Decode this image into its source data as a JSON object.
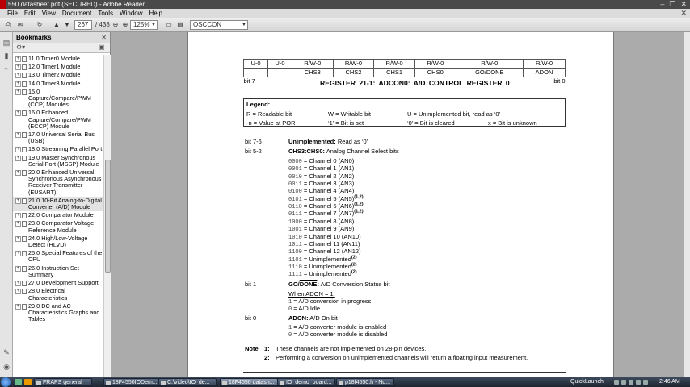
{
  "window": {
    "title": "550 datasheet.pdf (SECURED) - Adobe Reader",
    "controls": [
      "–",
      "❐",
      "✕"
    ]
  },
  "menu": [
    "File",
    "Edit",
    "View",
    "Document",
    "Tools",
    "Window",
    "Help"
  ],
  "toolbar": {
    "current_page": "267",
    "total_pages": "/ 438",
    "zoom": "125%",
    "search": "OSCCON"
  },
  "bookmarks_panel": {
    "title": "Bookmarks",
    "items": [
      {
        "label": "11.0 Timer0 Module",
        "expand": "+",
        "selected": false
      },
      {
        "label": "12.0 Timer1 Module",
        "expand": "+",
        "selected": false
      },
      {
        "label": "13.0 Timer2 Module",
        "expand": "+",
        "selected": false
      },
      {
        "label": "14.0 Timer3 Module",
        "expand": "+",
        "selected": false
      },
      {
        "label": "15.0 Capture/Compare/PWM (CCP) Modules",
        "expand": "+",
        "selected": false
      },
      {
        "label": "16.0 Enhanced Capture/Compare/PWM (ECCP) Module",
        "expand": "+",
        "selected": false
      },
      {
        "label": "17.0 Universal Serial Bus (USB)",
        "expand": "+",
        "selected": false
      },
      {
        "label": "18.0 Streaming Parallel Port",
        "expand": "+",
        "selected": false
      },
      {
        "label": "19.0 Master Synchronous Serial Port (MSSP) Module",
        "expand": "+",
        "selected": false
      },
      {
        "label": "20.0 Enhanced Universal Synchronous Asynchronous Receiver Transmitter (EUSART)",
        "expand": "+",
        "selected": false
      },
      {
        "label": "21.0 10-Bit Analog-to-Digital Converter (A/D) Module",
        "expand": "+",
        "selected": true
      },
      {
        "label": "22.0 Comparator Module",
        "expand": "+",
        "selected": false
      },
      {
        "label": "23.0 Comparator Voltage Reference Module",
        "expand": "+",
        "selected": false
      },
      {
        "label": "24.0 High/Low-Voltage Detect (HLVD)",
        "expand": "+",
        "selected": false
      },
      {
        "label": "25.0 Special Features of the CPU",
        "expand": "+",
        "selected": false
      },
      {
        "label": "26.0 Instruction Set Summary",
        "expand": "+",
        "selected": false
      },
      {
        "label": "27.0 Development Support",
        "expand": "+",
        "selected": false
      },
      {
        "label": "28.0 Electrical Characteristics",
        "expand": "+",
        "selected": false
      },
      {
        "label": "29.0 DC and AC Characteristics Graphs and Tables",
        "expand": "+",
        "selected": false
      }
    ]
  },
  "register": {
    "title": "REGISTER 21-1:    ADCON0: A/D CONTROL REGISTER 0",
    "access": [
      "U-0",
      "U-0",
      "R/W-0",
      "R/W-0",
      "R/W-0",
      "R/W-0",
      "R/W-0",
      "R/W-0"
    ],
    "bits": [
      "—",
      "—",
      "CHS3",
      "CHS2",
      "CHS1",
      "CHS0",
      "GO/DONE",
      "ADON"
    ],
    "bit_left": "bit 7",
    "bit_right": "bit 0"
  },
  "legend": {
    "title": "Legend:",
    "r": "R = Readable bit",
    "w": "W = Writable bit",
    "u": "U = Unimplemented bit, read as ‘0’",
    "n": "-n = Value at POR",
    "set": "‘1’ = Bit is set",
    "cleared": "‘0’ = Bit is cleared",
    "unknown": "x = Bit is unknown"
  },
  "bit76": {
    "range": "bit 7-6",
    "name": "Unimplemented:",
    "desc": "Read as ‘0’"
  },
  "bit52": {
    "range": "bit 5-2",
    "name": "CHS3:CHS0:",
    "desc": "Analog Channel Select bits",
    "channels": [
      {
        "code": "0000",
        "text": "= Channel 0 (AN0)",
        "note": ""
      },
      {
        "code": "0001",
        "text": "= Channel 1 (AN1)",
        "note": ""
      },
      {
        "code": "0010",
        "text": "= Channel 2 (AN2)",
        "note": ""
      },
      {
        "code": "0011",
        "text": "= Channel 3 (AN3)",
        "note": ""
      },
      {
        "code": "0100",
        "text": "= Channel 4 (AN4)",
        "note": ""
      },
      {
        "code": "0101",
        "text": "= Channel 5 (AN5)",
        "note": "(1,2)"
      },
      {
        "code": "0110",
        "text": "= Channel 6 (AN6)",
        "note": "(1,2)"
      },
      {
        "code": "0111",
        "text": "= Channel 7 (AN7)",
        "note": "(1,2)"
      },
      {
        "code": "1000",
        "text": "= Channel 8 (AN8)",
        "note": ""
      },
      {
        "code": "1001",
        "text": "= Channel 9 (AN9)",
        "note": ""
      },
      {
        "code": "1010",
        "text": "= Channel 10 (AN10)",
        "note": ""
      },
      {
        "code": "1011",
        "text": "= Channel 11 (AN11)",
        "note": ""
      },
      {
        "code": "1100",
        "text": "= Channel 12 (AN12)",
        "note": ""
      },
      {
        "code": "1101",
        "text": "= Unimplemented",
        "note": "(2)"
      },
      {
        "code": "1110",
        "text": "= Unimplemented",
        "note": "(2)"
      },
      {
        "code": "1111",
        "text": "= Unimplemented",
        "note": "(2)"
      }
    ]
  },
  "bit1": {
    "range": "bit 1",
    "name_a": "GO/",
    "name_b": "DONE",
    "name_c": ":",
    "desc": "A/D Conversion Status bit",
    "when": "When ADON = 1:",
    "v1_code": "1",
    "v1": "= A/D conversion in progress",
    "v0_code": "0",
    "v0": "= A/D Idle"
  },
  "bit0": {
    "range": "bit 0",
    "name": "ADON:",
    "desc": "A/D On bit",
    "v1_code": "1",
    "v1": "= A/D converter module is enabled",
    "v0_code": "0",
    "v0": "= A/D converter module is disabled"
  },
  "notes": {
    "label": "Note",
    "n1_num": "1:",
    "n1": "These channels are not implemented on 28-pin devices.",
    "n2_num": "2:",
    "n2": "Performing a conversion on unimplemented channels will return a floating input measurement."
  },
  "taskbar": {
    "tasks": [
      {
        "label": "FRAPS general",
        "active": false
      },
      {
        "label": "18F4550IODem...",
        "active": false
      },
      {
        "label": "C:\\video\\IO_de...",
        "active": false
      },
      {
        "label": "18F4550 datash...",
        "active": true
      },
      {
        "label": "IO_demo_board...",
        "active": false
      },
      {
        "label": "p18f4550.h - No...",
        "active": false
      }
    ],
    "quicklaunch": "QuickLaunch",
    "clock": "2:46 AM"
  }
}
